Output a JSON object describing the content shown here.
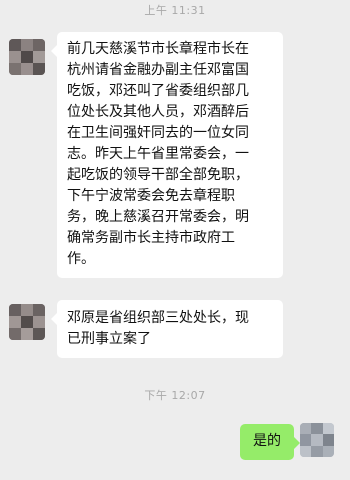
{
  "timestamps": [
    "上午 11:31",
    "下午 12:07"
  ],
  "messages": [
    {
      "sender": "other",
      "lines": [
        "前几天慈溪节市长章程市长在",
        "杭州请省金融办副主任邓富国",
        "吃饭，邓还叫了省委组织部几",
        "位处长及其他人员，邓酒醉后",
        "在卫生间强奸同去的一位女同",
        "志。昨天上午省里常委会，一",
        "起吃饭的领导干部全部免职，",
        "下午宁波常委会免去章程职",
        "务，晚上慈溪召开常委会，明",
        "确常务副市长主持市政府工",
        "作。"
      ]
    },
    {
      "sender": "other",
      "lines": [
        "邓原是省组织部三处处长，现",
        "已刑事立案了"
      ]
    },
    {
      "sender": "me",
      "text": "是的"
    }
  ],
  "colors": {
    "background": "#ededed",
    "incoming_bubble": "#ffffff",
    "outgoing_bubble": "#95ec69",
    "timestamp_text": "#a8a8a8"
  },
  "avatars": {
    "incoming": "blurred-avatar-icon",
    "outgoing": "blurred-avatar-icon"
  }
}
